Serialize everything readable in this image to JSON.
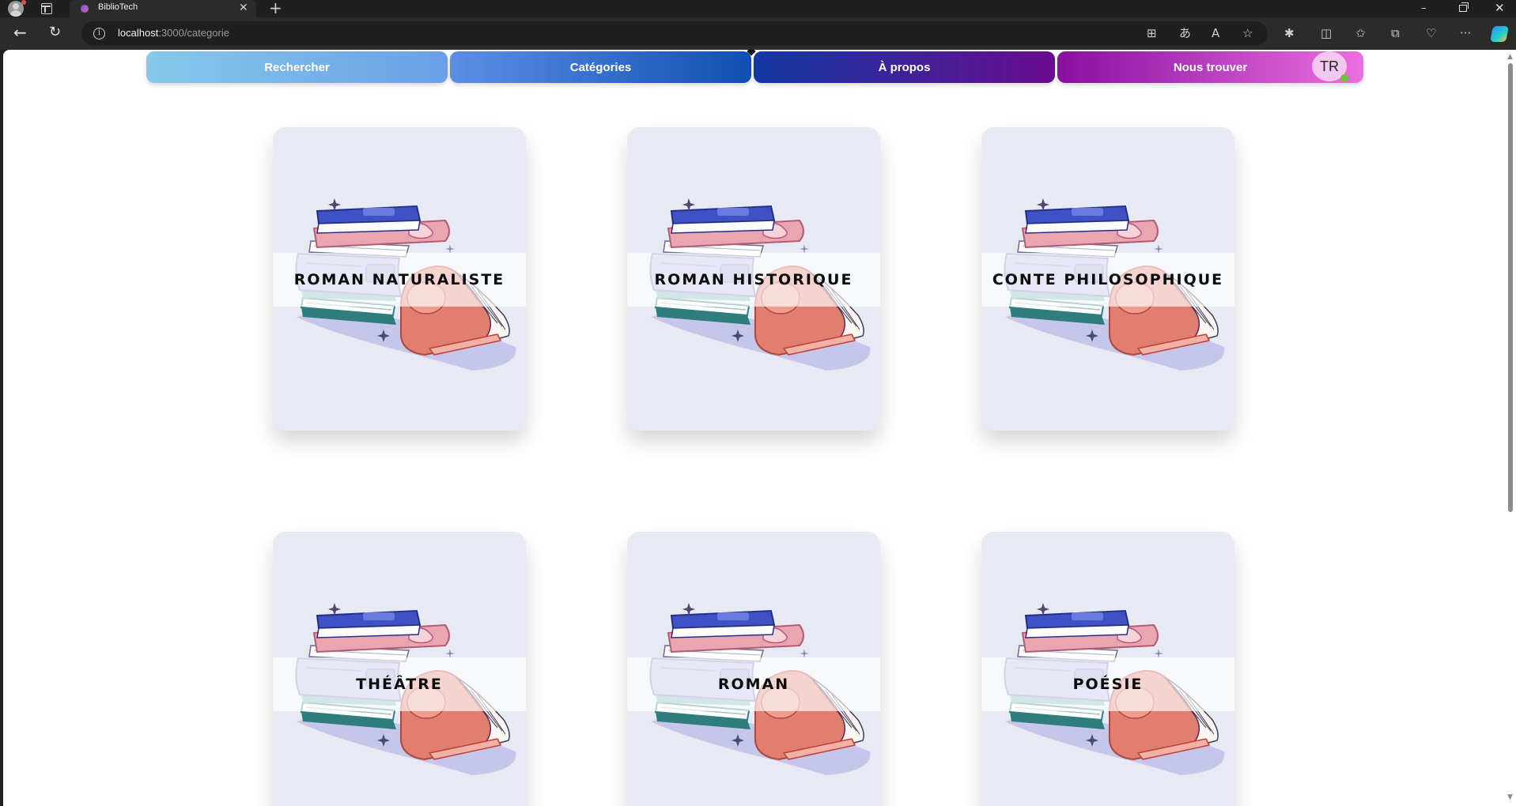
{
  "browser": {
    "tab_title": "BiblioTech",
    "tab_close": "✕",
    "new_tab": "+",
    "url_host": "localhost",
    "url_path": ":3000/categorie",
    "info_glyph": "i",
    "back_glyph": "←",
    "reload_glyph": "↻",
    "window_min": "–",
    "window_close": "✕"
  },
  "toolbar_icons": [
    {
      "name": "app-available-icon",
      "glyph": "⊞"
    },
    {
      "name": "translate-icon",
      "glyph": "あ"
    },
    {
      "name": "read-aloud-icon",
      "glyph": "A"
    },
    {
      "name": "favorite-star-icon",
      "glyph": "☆"
    },
    {
      "name": "extensions-icon",
      "glyph": "✱"
    },
    {
      "name": "split-screen-icon",
      "glyph": "◫"
    },
    {
      "name": "favorites-icon",
      "glyph": "✩"
    },
    {
      "name": "collections-icon",
      "glyph": "⧉"
    },
    {
      "name": "browser-essentials-icon",
      "glyph": "♡"
    },
    {
      "name": "more-icon",
      "glyph": "···"
    }
  ],
  "nav": {
    "search": "Rechercher",
    "categories": "Catégories",
    "about": "À propos",
    "find_us": "Nous trouver",
    "avatar_initials": "TR"
  },
  "categories": [
    "ROMAN NATURALISTE",
    "ROMAN HISTORIQUE",
    "CONTE PHILOSOPHIQUE",
    "THÉÂTRE",
    "ROMAN",
    "POÉSIE"
  ],
  "colors": {
    "card_bg": "#e8eaf3",
    "book_blue": "#3f51c4",
    "book_pink": "#e9a0b0",
    "book_lavender": "#b8b5e3",
    "book_teal": "#2f7d7f",
    "book_coral": "#e17e70",
    "online": "#72c23b"
  },
  "scrollbar": {
    "up": "▲",
    "down": "▼"
  }
}
